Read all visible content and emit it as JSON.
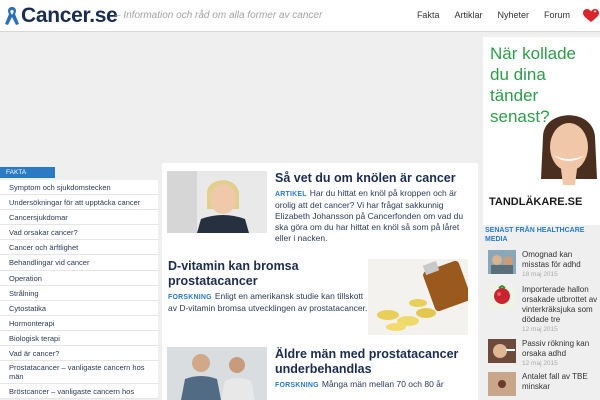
{
  "header": {
    "logo_text": "Cancer.se",
    "tagline": "– Information och råd om alla former av cancer",
    "nav": [
      "Fakta",
      "Artiklar",
      "Nyheter",
      "Forum"
    ]
  },
  "ad": {
    "headline": "När kollade du dina tänder senast?",
    "brand": "TANDLÄKARE.SE"
  },
  "right_sidebar": {
    "header": "SENAST FRÅN HEALTHCARE MEDIA",
    "items": [
      {
        "title": "Omognad kan misstas för adhd",
        "date": "18 maj 2015"
      },
      {
        "title": "Importerade hallon orsakade utbrottet av vinterkräksjuka som dödade tre",
        "date": "12 maj 2015"
      },
      {
        "title": "Passiv rökning kan orsaka adhd",
        "date": "12 maj 2015"
      },
      {
        "title": "Antalet fall av TBE minskar",
        "date": ""
      }
    ]
  },
  "left_sidebar": {
    "header": "FAKTA",
    "items": [
      "Symptom och sjukdomstecken",
      "Undersökningar för att upptäcka cancer",
      "Cancersjukdomar",
      "Vad orsakar cancer?",
      "Cancer och ärftlighet",
      "Behandlingar vid cancer",
      "Operation",
      "Strålning",
      "Cytostatika",
      "Hormonterapi",
      "Biologisk terapi",
      "Vad är cancer?",
      "Prostatacancer – vanligaste cancern hos män",
      "Bröstcancer – vanligaste cancern hos"
    ]
  },
  "articles": [
    {
      "title": "Så vet du om knölen är cancer",
      "category": "ARTIKEL",
      "body": "Har du hittat en knöl på kroppen och är orolig att det cancer? Vi har frågat sakkunnig Elizabeth Johansson på Cancerfonden om vad du ska göra om du har hittat en knöl så som på låret eller i nacken."
    },
    {
      "title": "D-vitamin kan bromsa prostatacancer",
      "category": "FORSKNING",
      "body": "Enligt en amerikansk studie kan tillskott av D-vitamin bromsa utvecklingen av prostatacancer."
    },
    {
      "title": "Äldre män med prostatacancer underbehandlas",
      "category": "FORSKNING",
      "body": "Många män mellan 70 och 80 år"
    }
  ],
  "colors": {
    "brand_navy": "#1b2d4f",
    "accent_blue": "#2a7ac4",
    "ad_green": "#2f9b4a",
    "heart_red": "#d9252b"
  }
}
